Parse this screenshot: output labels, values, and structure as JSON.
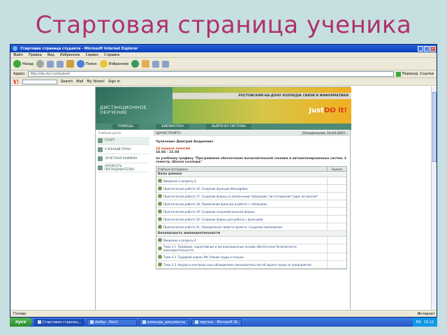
{
  "slide_title": "Стартовая страница ученика",
  "window": {
    "title": "Стартовая страница студента - Microsoft Internet Explorer",
    "menu": [
      "Файл",
      "Правка",
      "Вид",
      "Избранное",
      "Сервис",
      "Справка"
    ],
    "toolbar": {
      "back": "Назад",
      "search": "Поиск",
      "favorites": "Избранное"
    },
    "address_label": "Адрес:",
    "address_value": "http://ido.rksi.ru/student/",
    "go_label": "Переход",
    "links_label": "Ссылки",
    "yahoo": {
      "logo": "Y!",
      "search": "Search",
      "mail": "Mail",
      "my_yahoo": "My Yahoo!",
      "signin": "Sign In"
    },
    "status_left": "Готово",
    "status_right": "Интернет"
  },
  "site": {
    "college": "РОСТОВСКИЙ-НА-ДОНУ КОЛЛЕДЖ СВЯЗИ И ИНФОРМАТИКИ",
    "logo_line1": "ДИСТАНЦИОННОЕ",
    "logo_line2": "ОБУЧЕНИЕ",
    "justdo": "Just",
    "justdo_it": "DO it!",
    "nav": [
      "ПОМОЩЬ",
      "БИБЛИОТЕКА",
      "ВЫЙТИ ИЗ СИСТЕМЫ"
    ],
    "sidebar_head": "Учебный центр",
    "sidebar": [
      "СТАРТ",
      "УЧЕБНЫЙ ПЛАН",
      "ЗАЧЕТНАЯ КНИЖКА",
      "НАПИСАТЬ ПРЕПОДАВАТЕЛЮ"
    ],
    "greeting": "ЗДРАВСТВУЙТЕ!",
    "date": "Понедельник, 16.04.2007",
    "student_name": "Чупачевич Дмитрий Андреевич",
    "week": "14 неделя занятий",
    "dates": "16.04 - 22.04",
    "schedule": "по учебному графику \"Программное обеспечение вычислительной техники и автоматизированных систем, 2 семестр, Школа колледж\"",
    "table_head": [
      "Учебные материалы",
      "Оценка"
    ],
    "sections": [
      {
        "title": "Базы данных",
        "items": [
          "Введение к разделу 4",
          "Практическая работа 16. Создание функции Messagebox",
          "Практическая работа 17. Создание формы со связанными таблицами, тип отношения \"один ко многим\"",
          "Практическая работа 18. Применение фильтра в работе с таблицами",
          "Практическая работа 19. Создание пользовательской формы",
          "Практическая работа 20. Создание формы для работы с функцией",
          "Практическая работа 21. Определение свойств проекта. Создание приложения"
        ]
      },
      {
        "title": "Безопасность жизнедеятельности",
        "items": [
          "Введение к разделу 4",
          "Тема 4.1. Правовые, нормативные и организационные основы обеспечения безопасности жизнедеятельности",
          "Тема 4.2. Трудовой кодекс РФ. Режим труда и отдыха",
          "Тема 4.3. Надзор и контроль над соблюдением законодательства об охране труда на предприятии"
        ]
      }
    ]
  },
  "taskbar": {
    "start": "пуск",
    "tasks": [
      "Стартовая страниц...",
      "dodkp - Paint",
      "команда_документы",
      "чертеж - Microsoft W..."
    ],
    "lang": "EN",
    "clock": "10:12"
  }
}
